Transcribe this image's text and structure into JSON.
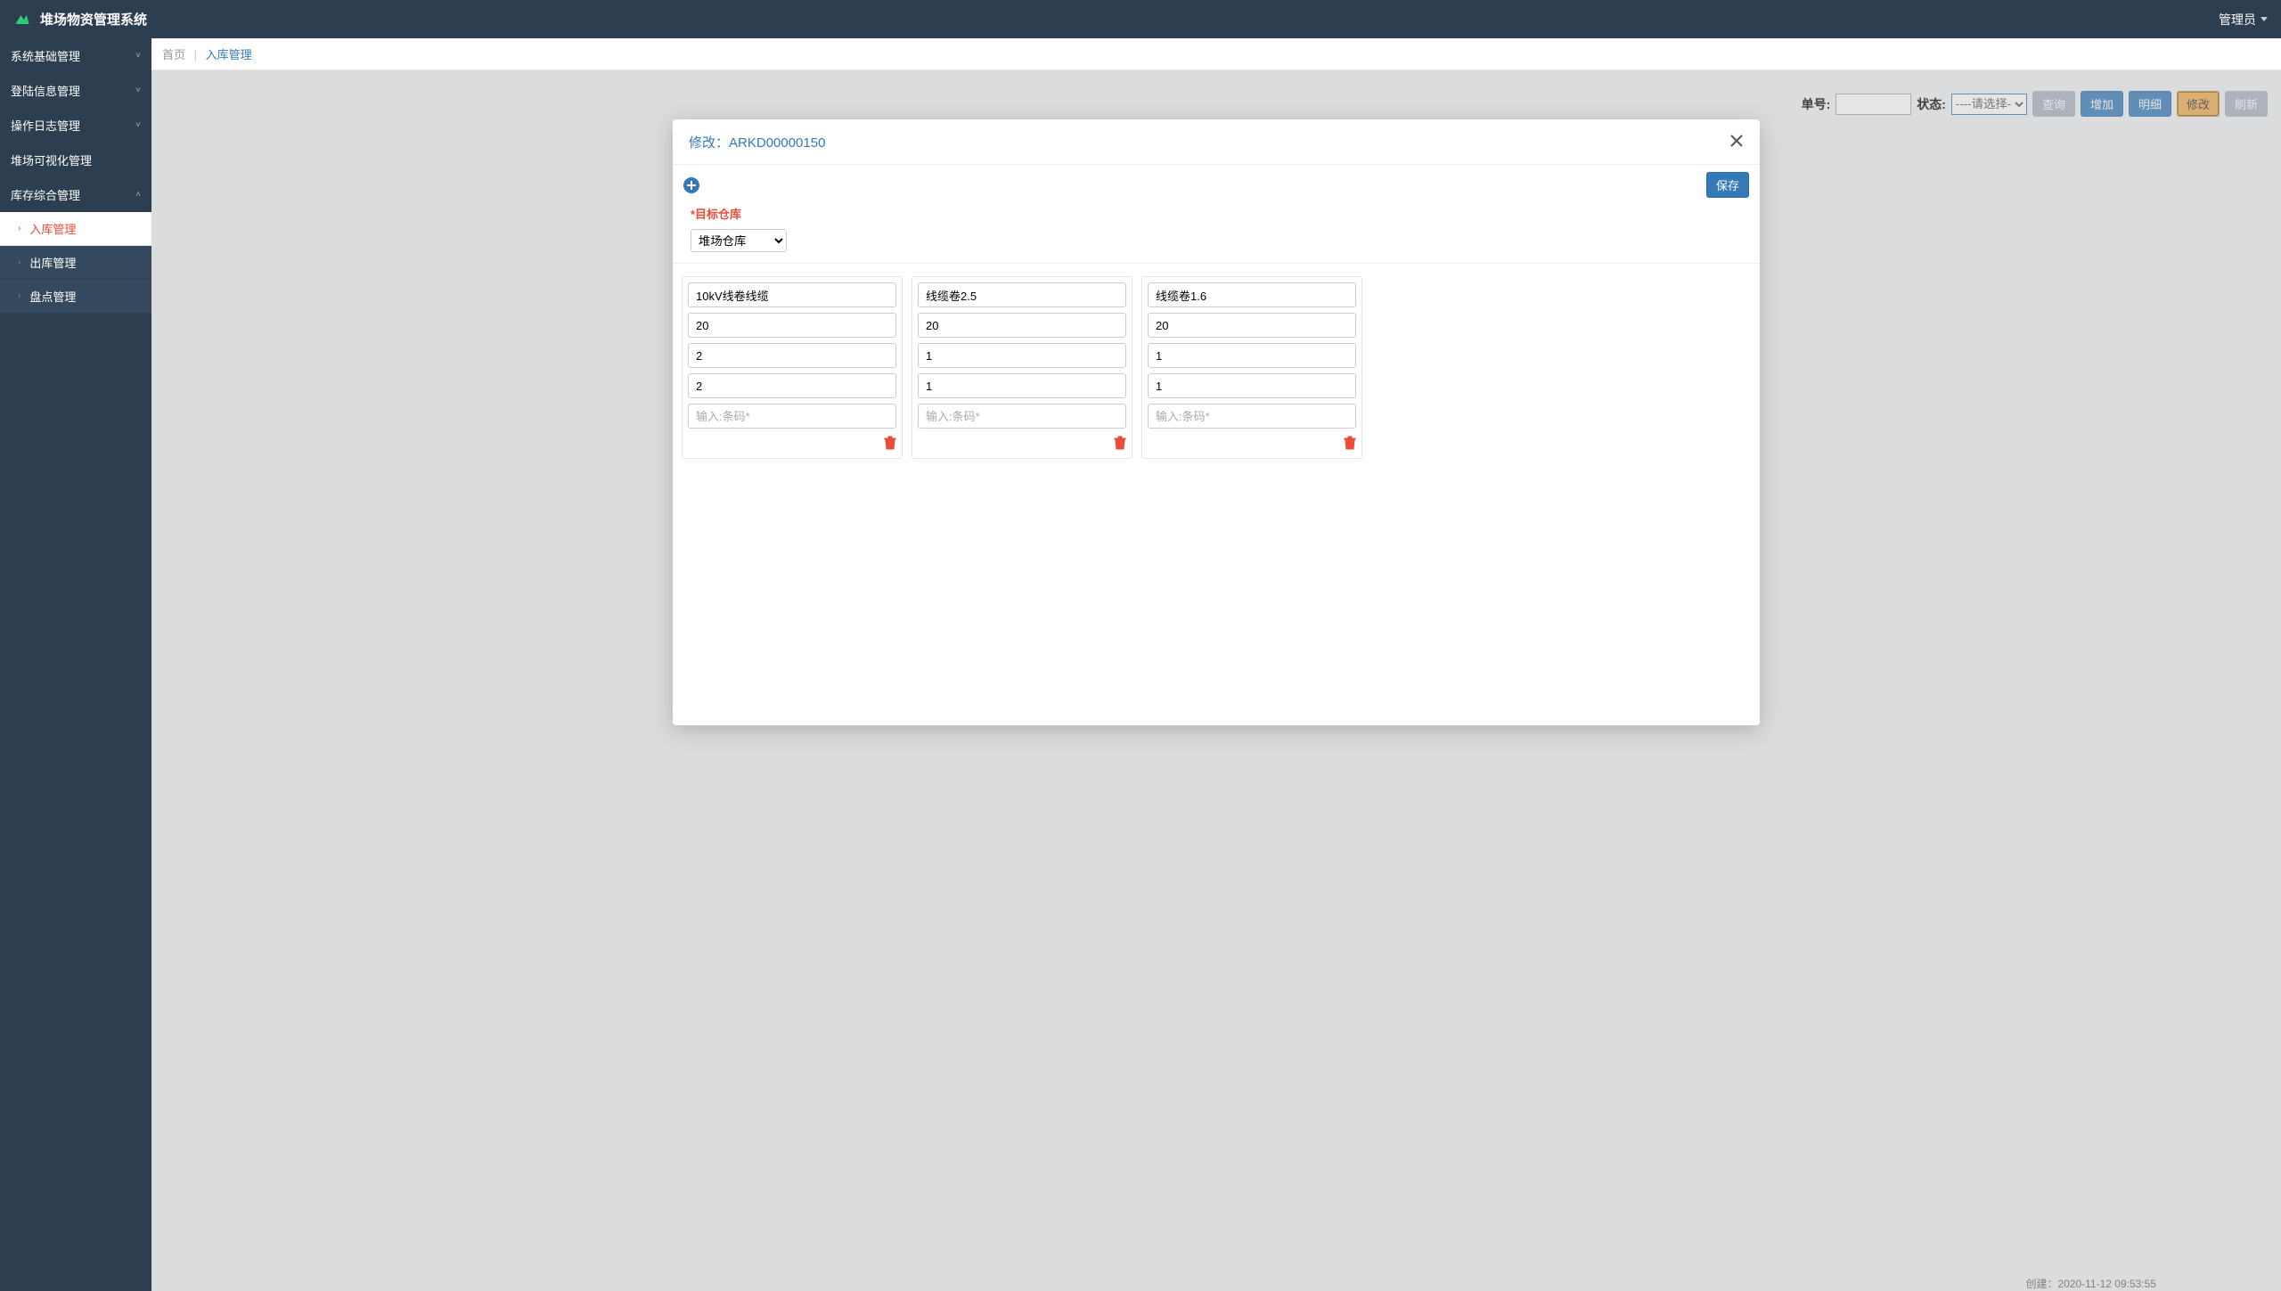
{
  "header": {
    "app_title": "堆场物资管理系统",
    "user_label": "管理员"
  },
  "sidebar": {
    "items": [
      {
        "label": "系统基础管理",
        "expanded": false
      },
      {
        "label": "登陆信息管理",
        "expanded": false
      },
      {
        "label": "操作日志管理",
        "expanded": false
      },
      {
        "label": "堆场可视化管理",
        "nochev": true
      },
      {
        "label": "库存综合管理",
        "expanded": true
      }
    ],
    "sub_items": [
      {
        "label": "入库管理",
        "active": true
      },
      {
        "label": "出库管理",
        "active": false
      },
      {
        "label": "盘点管理",
        "active": false
      }
    ]
  },
  "breadcrumb": {
    "home": "首页",
    "current": "入库管理"
  },
  "toolbar": {
    "order_label": "单号:",
    "status_label": "状态:",
    "status_placeholder": "----请选择----",
    "btn_query": "查询",
    "btn_add": "增加",
    "btn_detail": "明细",
    "btn_edit": "修改",
    "btn_refresh": "刷新"
  },
  "modal": {
    "title_prefix": "修改：",
    "order_id": "ARKD00000150",
    "btn_save": "保存",
    "target_label": "*目标仓库",
    "target_value": "堆场仓库",
    "barcode_placeholder": "输入:条码*",
    "cards": [
      {
        "name": "10kV线卷线缆",
        "f2": "20",
        "f3": "2",
        "f4": "2"
      },
      {
        "name": "线缆卷2.5",
        "f2": "20",
        "f3": "1",
        "f4": "1"
      },
      {
        "name": "线缆卷1.6",
        "f2": "20",
        "f3": "1",
        "f4": "1"
      }
    ]
  },
  "bg_peek": "创建：2020-11-12 09:53:55"
}
